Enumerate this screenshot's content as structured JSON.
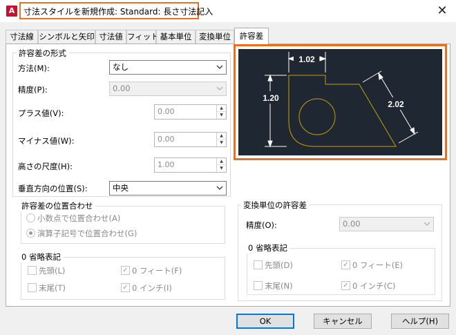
{
  "window": {
    "app_icon": "A",
    "title": "寸法スタイルを新規作成: Standard: 長さ寸法記入",
    "close_glyph": "✕",
    "accent_color": "#e8701e"
  },
  "tabs": [
    "寸法線",
    "シンボルと矢印",
    "寸法値",
    "フィット",
    "基本単位",
    "変換単位",
    "許容差"
  ],
  "active_tab": "許容差",
  "tolerance_format": {
    "group_label": "許容差の形式",
    "method_label": "方法(M):",
    "method_value": "なし",
    "precision_label": "精度(P):",
    "precision_value": "0.00",
    "upper_label": "プラス値(V):",
    "upper_value": "0.00",
    "lower_label": "マイナス値(W):",
    "lower_value": "0.00",
    "scale_label": "高さの尺度(H):",
    "scale_value": "1.00",
    "vertical_label": "垂直方向の位置(S):",
    "vertical_value": "中央"
  },
  "alignment": {
    "group_label": "許容差の位置合わせ",
    "option_decimal": "小数点で位置合わせ(A)",
    "option_operator": "演算子記号で位置合わせ(G)",
    "selected": "演算子記号で位置合わせ(G)"
  },
  "zero_suppression": {
    "group_label": "0 省略表記",
    "leading": "先頭(L)",
    "trailing": "末尾(T)",
    "feet": "0 フィート(F)",
    "inches": "0 インチ(I)",
    "feet_checked": true,
    "inches_checked": true
  },
  "preview": {
    "dim_top": "1.02",
    "dim_left": "1.20",
    "dim_diag": "2.02",
    "background": "#1f2732",
    "line_color": "#ffffff",
    "shape_color": "#c8a000"
  },
  "alt_unit_tolerance": {
    "group_label": "変換単位の許容差",
    "precision_label": "精度(O):",
    "precision_value": "0.00",
    "zero_group_label": "0 省略表記",
    "leading": "先頭(D)",
    "trailing": "末尾(N)",
    "feet": "0 フィート(E)",
    "inches": "0 インチ(C)",
    "feet_checked": true,
    "inches_checked": true
  },
  "buttons": {
    "ok": "OK",
    "cancel": "キャンセル",
    "help": "ヘルプ(H)"
  }
}
